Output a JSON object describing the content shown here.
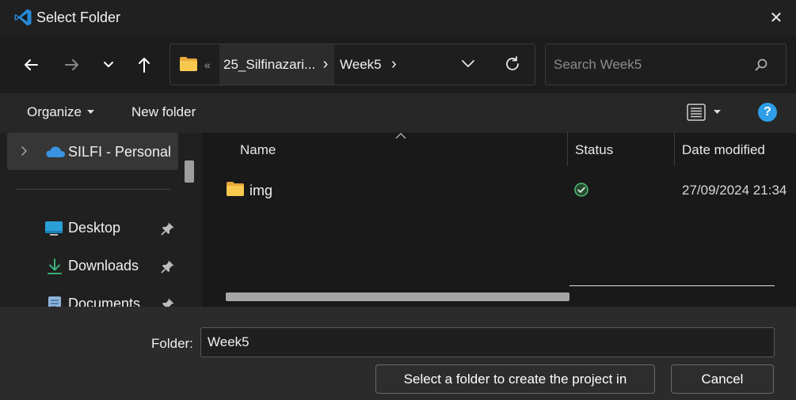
{
  "window": {
    "title": "Select Folder",
    "close_glyph": "✕"
  },
  "nav": {
    "back_glyph": "←",
    "forward_glyph": "→",
    "recent_glyph": "⌄",
    "up_glyph": "↑"
  },
  "address": {
    "overflow": "«",
    "crumbs": [
      "25_Silfinazari...",
      "Week5"
    ],
    "sep": "›"
  },
  "search": {
    "placeholder": "Search Week5"
  },
  "commandbar": {
    "organize_label": "Organize",
    "new_folder_label": "New folder",
    "help_label": "?"
  },
  "sidebar": {
    "onedrive_label": "SILFI - Personal",
    "items": [
      {
        "label": "Desktop"
      },
      {
        "label": "Downloads"
      },
      {
        "label": "Documents"
      }
    ]
  },
  "columns": {
    "name": "Name",
    "status": "Status",
    "date": "Date modified"
  },
  "files": [
    {
      "name": "img",
      "date": "27/09/2024 21:34"
    }
  ],
  "footer": {
    "folder_label": "Folder:",
    "folder_value": "Week5",
    "select_button": "Select a folder to create the project in",
    "cancel_button": "Cancel"
  },
  "colors": {
    "accent": "#2f9ee8",
    "folder": "#f5c342",
    "status_ok": "#3ea25e"
  }
}
